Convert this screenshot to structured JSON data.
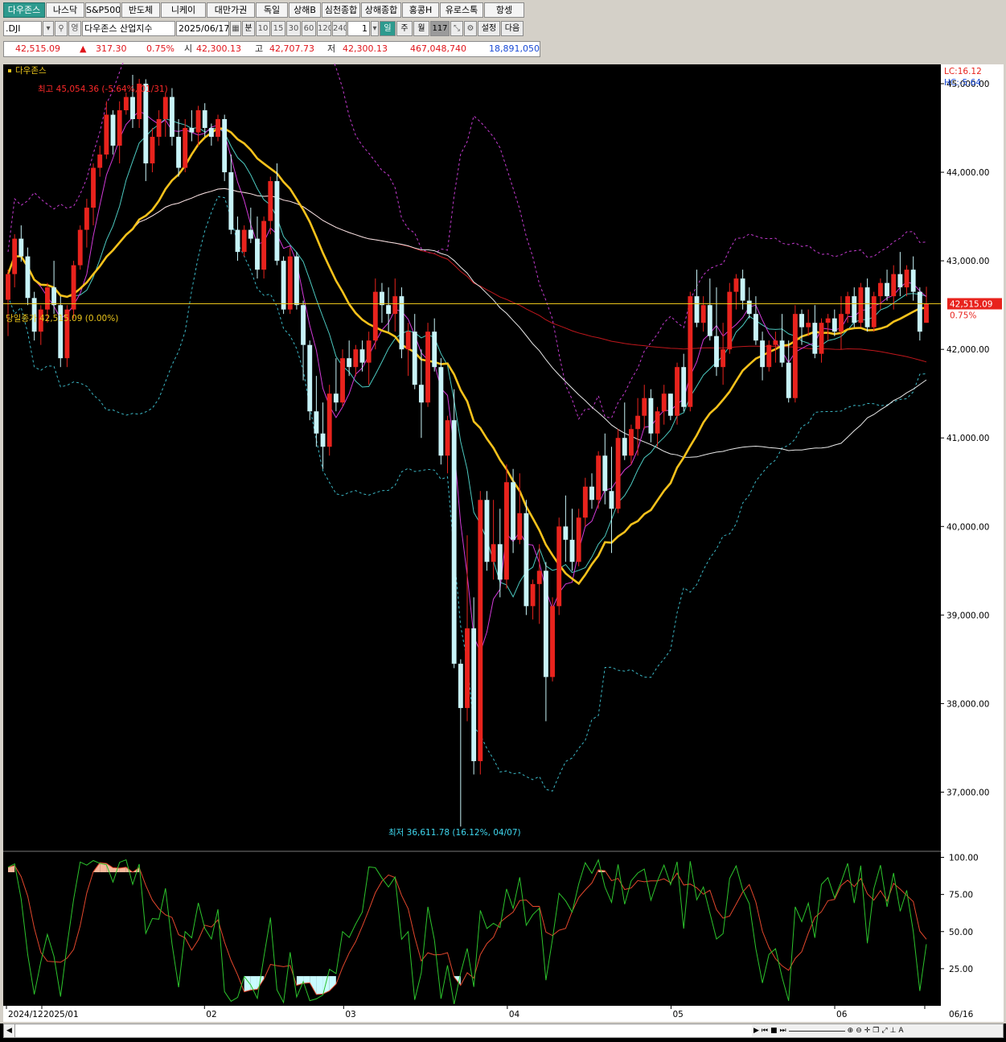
{
  "tabs": [
    "다우존스",
    "나스닥",
    "S&P500",
    "반도체",
    "니케이",
    "대만가권",
    "독일",
    "상해B",
    "심천종합",
    "상해종합",
    "홍콩H",
    "유로스톡",
    "항셍"
  ],
  "toolbar": {
    "symbol": ".DJI",
    "name": "다우존스 산업지수",
    "date": "2025/06/17",
    "minute_label": "분",
    "intervals": [
      "10",
      "15",
      "30",
      "60",
      "120",
      "240"
    ],
    "count": "1",
    "day_label": "일",
    "week_label": "주",
    "month_label": "월",
    "bars": "117",
    "settings_label": "설정",
    "next_label": "다음"
  },
  "quote": {
    "price": "42,515.09",
    "change_arrow": "▲",
    "change": "317.30",
    "change_pct": "0.75%",
    "open_label": "시",
    "open": "42,300.13",
    "high_label": "고",
    "high": "42,707.73",
    "low_label": "저",
    "low": "42,300.13",
    "volume": "467,048,740",
    "value": "18,891,050"
  },
  "chart_labels": {
    "legend": "다우존스",
    "high_note": "최고 45,054.36 (-5.64%, 01/31)",
    "low_note": "최저 36,611.78 (16.12%, 04/07)",
    "today_close": "당일종가 42,515.09 (0.00%)",
    "lc": "LC:16.12",
    "hc": "HC:-5.64",
    "price_tag": "42,515.09",
    "pct_tag": "0.75%"
  },
  "colors": {
    "up": "#e8231d",
    "down": "#c8f4f8",
    "ma_yellow": "#f7c21b",
    "ma_white": "#e8e8e8",
    "ma_red": "#c0171c",
    "ma_magenta": "#d23ad8",
    "ma_cyan": "#4cc9c0",
    "band_upper": "#c43bd0",
    "band_lower": "#3bb6c4",
    "stoch_k": "#2cc42c",
    "stoch_d": "#e2472c"
  },
  "chart_data": {
    "type": "candlestick",
    "price_axis": {
      "ticks": [
        "45,000.00",
        "44,000.00",
        "43,000.00",
        "42,000.00",
        "41,000.00",
        "40,000.00",
        "39,000.00",
        "38,000.00",
        "37,000.00"
      ],
      "range": [
        36350,
        45200
      ]
    },
    "osc_axis": {
      "ticks": [
        "100.00",
        "75.00",
        "50.00",
        "25.00"
      ],
      "range": [
        0,
        103
      ]
    },
    "date_labels": [
      "2024/12",
      "2025/01",
      "02",
      "03",
      "04",
      "05",
      "06",
      "06/16"
    ],
    "candles": [
      [
        42560,
        42900,
        42150,
        42850
      ],
      [
        42850,
        43300,
        42700,
        43250
      ],
      [
        43250,
        43400,
        42990,
        43050
      ],
      [
        43050,
        43150,
        42500,
        42580
      ],
      [
        42580,
        42650,
        42100,
        42200
      ],
      [
        42200,
        42500,
        42050,
        42450
      ],
      [
        42450,
        42750,
        42300,
        42700
      ],
      [
        42700,
        43000,
        42400,
        42500
      ],
      [
        42500,
        42600,
        41800,
        41900
      ],
      [
        41900,
        42500,
        41800,
        42450
      ],
      [
        42450,
        43000,
        42350,
        42950
      ],
      [
        42950,
        43400,
        42900,
        43350
      ],
      [
        43350,
        43700,
        43150,
        43600
      ],
      [
        43600,
        44100,
        43400,
        44050
      ],
      [
        44050,
        44300,
        43950,
        44200
      ],
      [
        44200,
        44800,
        44150,
        44650
      ],
      [
        44650,
        44700,
        44200,
        44300
      ],
      [
        44300,
        44800,
        44100,
        44700
      ],
      [
        44700,
        44900,
        44650,
        44850
      ],
      [
        44850,
        45100,
        44500,
        44600
      ],
      [
        44600,
        45054,
        44500,
        45000
      ],
      [
        45000,
        45050,
        43900,
        44100
      ],
      [
        44100,
        44500,
        44000,
        44400
      ],
      [
        44400,
        44700,
        44300,
        44600
      ],
      [
        44600,
        44900,
        44400,
        44850
      ],
      [
        44850,
        44950,
        44300,
        44400
      ],
      [
        44400,
        44600,
        43950,
        44050
      ],
      [
        44050,
        44600,
        44000,
        44500
      ],
      [
        44500,
        44700,
        44350,
        44450
      ],
      [
        44450,
        44750,
        44300,
        44700
      ],
      [
        44700,
        44780,
        44400,
        44500
      ],
      [
        44500,
        44550,
        44300,
        44400
      ],
      [
        44400,
        44650,
        44350,
        44600
      ],
      [
        44600,
        44650,
        43900,
        44000
      ],
      [
        44000,
        44200,
        43300,
        43350
      ],
      [
        43350,
        43500,
        43000,
        43100
      ],
      [
        43100,
        43400,
        43050,
        43350
      ],
      [
        43350,
        43600,
        43200,
        43250
      ],
      [
        43250,
        43500,
        42800,
        42900
      ],
      [
        42900,
        43500,
        42800,
        43450
      ],
      [
        43450,
        43950,
        43300,
        43900
      ],
      [
        43900,
        44100,
        42950,
        43000
      ],
      [
        43000,
        43050,
        42400,
        42450
      ],
      [
        42450,
        43150,
        42400,
        43050
      ],
      [
        43050,
        43100,
        42450,
        42500
      ],
      [
        42500,
        42550,
        41650,
        42050
      ],
      [
        42050,
        42100,
        41200,
        41300
      ],
      [
        41300,
        41700,
        40900,
        41050
      ],
      [
        41050,
        41400,
        40650,
        40900
      ],
      [
        40900,
        41600,
        40800,
        41500
      ],
      [
        41500,
        41900,
        41300,
        41400
      ],
      [
        41400,
        42000,
        41350,
        41900
      ],
      [
        41900,
        42100,
        41700,
        41800
      ],
      [
        41800,
        42050,
        41700,
        42000
      ],
      [
        42000,
        42100,
        41750,
        41850
      ],
      [
        41850,
        42200,
        41600,
        42100
      ],
      [
        42100,
        42800,
        42000,
        42650
      ],
      [
        42650,
        42750,
        42300,
        42500
      ],
      [
        42500,
        42700,
        42200,
        42400
      ],
      [
        42400,
        42800,
        42200,
        42600
      ],
      [
        42600,
        42700,
        41900,
        42000
      ],
      [
        42000,
        42300,
        41700,
        42200
      ],
      [
        42200,
        42400,
        41550,
        41600
      ],
      [
        41600,
        42000,
        41000,
        41400
      ],
      [
        41400,
        42300,
        41350,
        42200
      ],
      [
        42200,
        42350,
        41750,
        41800
      ],
      [
        41800,
        41900,
        40700,
        40800
      ],
      [
        40800,
        41250,
        40600,
        41200
      ],
      [
        41200,
        41550,
        38400,
        38450
      ],
      [
        38450,
        38500,
        36611,
        37950
      ],
      [
        37950,
        39900,
        37800,
        38850
      ],
      [
        38850,
        39200,
        37200,
        37350
      ],
      [
        37350,
        40400,
        37200,
        40300
      ],
      [
        40300,
        40400,
        39500,
        39600
      ],
      [
        39600,
        40300,
        39400,
        39800
      ],
      [
        39800,
        40200,
        39200,
        39400
      ],
      [
        39400,
        40700,
        39300,
        40500
      ],
      [
        40500,
        40650,
        39700,
        39850
      ],
      [
        39850,
        40600,
        39800,
        40150
      ],
      [
        40150,
        40300,
        39000,
        39100
      ],
      [
        39100,
        39400,
        38950,
        39350
      ],
      [
        39350,
        39800,
        38900,
        39500
      ],
      [
        39500,
        39600,
        37800,
        38300
      ],
      [
        38300,
        39200,
        38250,
        39100
      ],
      [
        39100,
        40100,
        39000,
        40000
      ],
      [
        40000,
        40350,
        39600,
        39850
      ],
      [
        39850,
        40200,
        39500,
        39600
      ],
      [
        39600,
        40200,
        39550,
        40100
      ],
      [
        40100,
        40550,
        40000,
        40450
      ],
      [
        40450,
        40600,
        40200,
        40300
      ],
      [
        40300,
        40850,
        40200,
        40800
      ],
      [
        40800,
        41050,
        40250,
        40400
      ],
      [
        40400,
        40900,
        39700,
        40200
      ],
      [
        40200,
        41100,
        40150,
        41000
      ],
      [
        41000,
        41400,
        40750,
        40800
      ],
      [
        40800,
        41150,
        40700,
        41100
      ],
      [
        41100,
        41450,
        40800,
        41250
      ],
      [
        41250,
        41600,
        41100,
        41450
      ],
      [
        41450,
        41550,
        40950,
        41050
      ],
      [
        41050,
        41350,
        40900,
        41300
      ],
      [
        41300,
        41600,
        41150,
        41500
      ],
      [
        41500,
        41500,
        41200,
        41250
      ],
      [
        41250,
        41850,
        41150,
        41800
      ],
      [
        41800,
        41950,
        41300,
        41350
      ],
      [
        41350,
        42650,
        41300,
        42600
      ],
      [
        42600,
        42900,
        42250,
        42300
      ],
      [
        42300,
        42600,
        42200,
        42500
      ],
      [
        42500,
        42800,
        42100,
        42150
      ],
      [
        42150,
        42700,
        41700,
        41800
      ],
      [
        41800,
        42300,
        41600,
        42000
      ],
      [
        42000,
        42750,
        41950,
        42650
      ],
      [
        42650,
        42850,
        42450,
        42800
      ],
      [
        42800,
        42900,
        42450,
        42550
      ],
      [
        42550,
        42700,
        42350,
        42400
      ],
      [
        42400,
        42600,
        42050,
        42100
      ],
      [
        42100,
        42200,
        41650,
        41800
      ],
      [
        41800,
        42100,
        41750,
        42050
      ],
      [
        42050,
        42200,
        41850,
        42100
      ],
      [
        42100,
        42400,
        41800,
        41850
      ],
      [
        41850,
        42100,
        41400,
        41450
      ],
      [
        41450,
        42500,
        41400,
        42400
      ],
      [
        42400,
        42450,
        42050,
        42250
      ],
      [
        42250,
        42450,
        42150,
        42300
      ],
      [
        42300,
        42500,
        41900,
        41950
      ],
      [
        41950,
        42350,
        41850,
        42300
      ],
      [
        42300,
        42400,
        42100,
        42350
      ],
      [
        42350,
        42450,
        42150,
        42200
      ],
      [
        42200,
        42600,
        42000,
        42400
      ],
      [
        42400,
        42650,
        42300,
        42600
      ],
      [
        42600,
        42700,
        42250,
        42300
      ],
      [
        42300,
        42750,
        42250,
        42700
      ],
      [
        42700,
        42800,
        42200,
        42250
      ],
      [
        42250,
        42650,
        42200,
        42600
      ],
      [
        42600,
        42800,
        42450,
        42750
      ],
      [
        42750,
        42900,
        42550,
        42600
      ],
      [
        42600,
        42950,
        42450,
        42850
      ],
      [
        42850,
        43100,
        42600,
        42700
      ],
      [
        42700,
        42950,
        42600,
        42900
      ],
      [
        42900,
        43050,
        42550,
        42650
      ],
      [
        42650,
        42700,
        42100,
        42200
      ],
      [
        42300,
        42707,
        42300,
        42515
      ]
    ]
  }
}
